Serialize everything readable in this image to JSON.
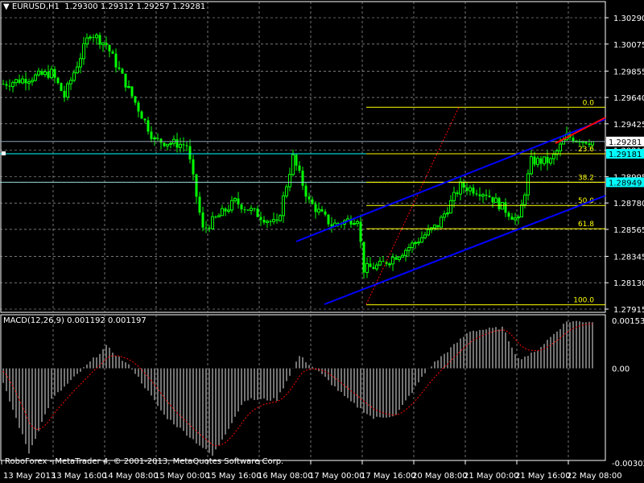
{
  "header": {
    "symbol": "EURUSD,H1",
    "open": "1.29300",
    "high": "1.29312",
    "low": "1.29257",
    "close": "1.29281"
  },
  "macd": {
    "label": "MACD(12,26,9)",
    "main": "0.001192",
    "signal": "0.001197",
    "axis": [
      "0.001534",
      "0.00",
      "-0.003025"
    ]
  },
  "footer": "RoboForex - MetaTrader 4, © 2001-2013, MetaQuotes Software Corp.",
  "colors": {
    "bull": "#00ff00",
    "grid": "#c0c0c0",
    "channel": "#0000ff",
    "fib": "#ffff00",
    "hline": "#00ffff",
    "red": "#ff0000"
  },
  "price_marks": {
    "bid": "1.29281",
    "line1": "1.29181",
    "line2": "1.28949"
  },
  "fib_levels": [
    {
      "label": "0.0",
      "price": 1.2956
    },
    {
      "label": "23.6",
      "price": 1.29181
    },
    {
      "label": "38.2",
      "price": 1.28949
    },
    {
      "label": "50.0",
      "price": 1.2876
    },
    {
      "label": "61.8",
      "price": 1.2857
    },
    {
      "label": "100.0",
      "price": 1.2795
    }
  ],
  "chart_data": {
    "type": "candlestick",
    "title": "EURUSD,H1",
    "timeframe": "H1",
    "y_ticks": [
      "1.30290",
      "1.30075",
      "1.29855",
      "1.29640",
      "1.29425",
      "1.29210",
      "1.28995",
      "1.28780",
      "1.28565",
      "1.28345",
      "1.28130",
      "1.27915"
    ],
    "x_ticks": [
      "13 May 2013",
      "13 May 16:00",
      "14 May 08:00",
      "15 May 00:00",
      "15 May 16:00",
      "16 May 08:00",
      "17 May 00:00",
      "17 May 16:00",
      "20 May 08:00",
      "21 May 00:00",
      "21 May 16:00",
      "22 May 08:00"
    ],
    "ylim": [
      1.27915,
      1.3029
    ],
    "close_path": [
      [
        0,
        1.2975
      ],
      [
        15,
        1.2984
      ],
      [
        19,
        1.2965
      ],
      [
        27,
        1.3017
      ],
      [
        32,
        1.3007
      ],
      [
        40,
        1.2965
      ],
      [
        47,
        1.2929
      ],
      [
        57,
        1.2925
      ],
      [
        62,
        1.2856
      ],
      [
        72,
        1.2879
      ],
      [
        85,
        1.286
      ],
      [
        90,
        1.2915
      ],
      [
        95,
        1.2879
      ],
      [
        102,
        1.286
      ],
      [
        110,
        1.2866
      ],
      [
        112,
        1.2824
      ],
      [
        117,
        1.2827
      ],
      [
        125,
        1.284
      ],
      [
        135,
        1.286
      ],
      [
        142,
        1.2892
      ],
      [
        150,
        1.2886
      ],
      [
        160,
        1.2863
      ],
      [
        164,
        1.2912
      ],
      [
        170,
        1.2912
      ],
      [
        175,
        1.2932
      ],
      [
        183,
        1.2928
      ]
    ],
    "macd_hist_path": [
      [
        0,
        -0.0005
      ],
      [
        8,
        -0.0027
      ],
      [
        15,
        -0.001
      ],
      [
        32,
        0.0007
      ],
      [
        40,
        0
      ],
      [
        50,
        -0.0015
      ],
      [
        65,
        -0.0028
      ],
      [
        75,
        -0.001
      ],
      [
        85,
        -0.001
      ],
      [
        92,
        0.0004
      ],
      [
        100,
        -0.0003
      ],
      [
        107,
        -0.001
      ],
      [
        115,
        -0.0016
      ],
      [
        122,
        -0.0015
      ],
      [
        132,
        0
      ],
      [
        145,
        0.0012
      ],
      [
        155,
        0.0013
      ],
      [
        160,
        0.0003
      ],
      [
        165,
        0.0005
      ],
      [
        175,
        0.0015
      ],
      [
        185,
        0.0015
      ]
    ],
    "macd_ylim": [
      -0.003025,
      0.001534
    ]
  }
}
